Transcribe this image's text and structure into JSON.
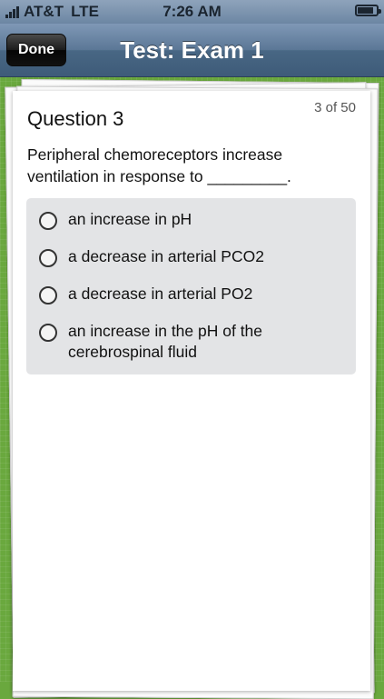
{
  "status_bar": {
    "carrier": "AT&T",
    "network": "LTE",
    "time": "7:26 AM",
    "signal_bars": 4,
    "battery_level": 0.85
  },
  "nav": {
    "done_label": "Done",
    "title": "Test: Exam 1"
  },
  "question": {
    "counter": "3 of 50",
    "title": "Question 3",
    "text": "Peripheral chemoreceptors increase ventilation in response to _________.",
    "options": [
      {
        "label": "an increase in pH"
      },
      {
        "label": "a decrease in arterial PCO2"
      },
      {
        "label": "a decrease in arterial PO2"
      },
      {
        "label": "an increase in the pH of the cerebrospinal fluid"
      }
    ]
  },
  "colors": {
    "background_green": "#6aa83e",
    "navbar_blue": "#4a6a8a",
    "options_panel": "#e3e4e6"
  }
}
